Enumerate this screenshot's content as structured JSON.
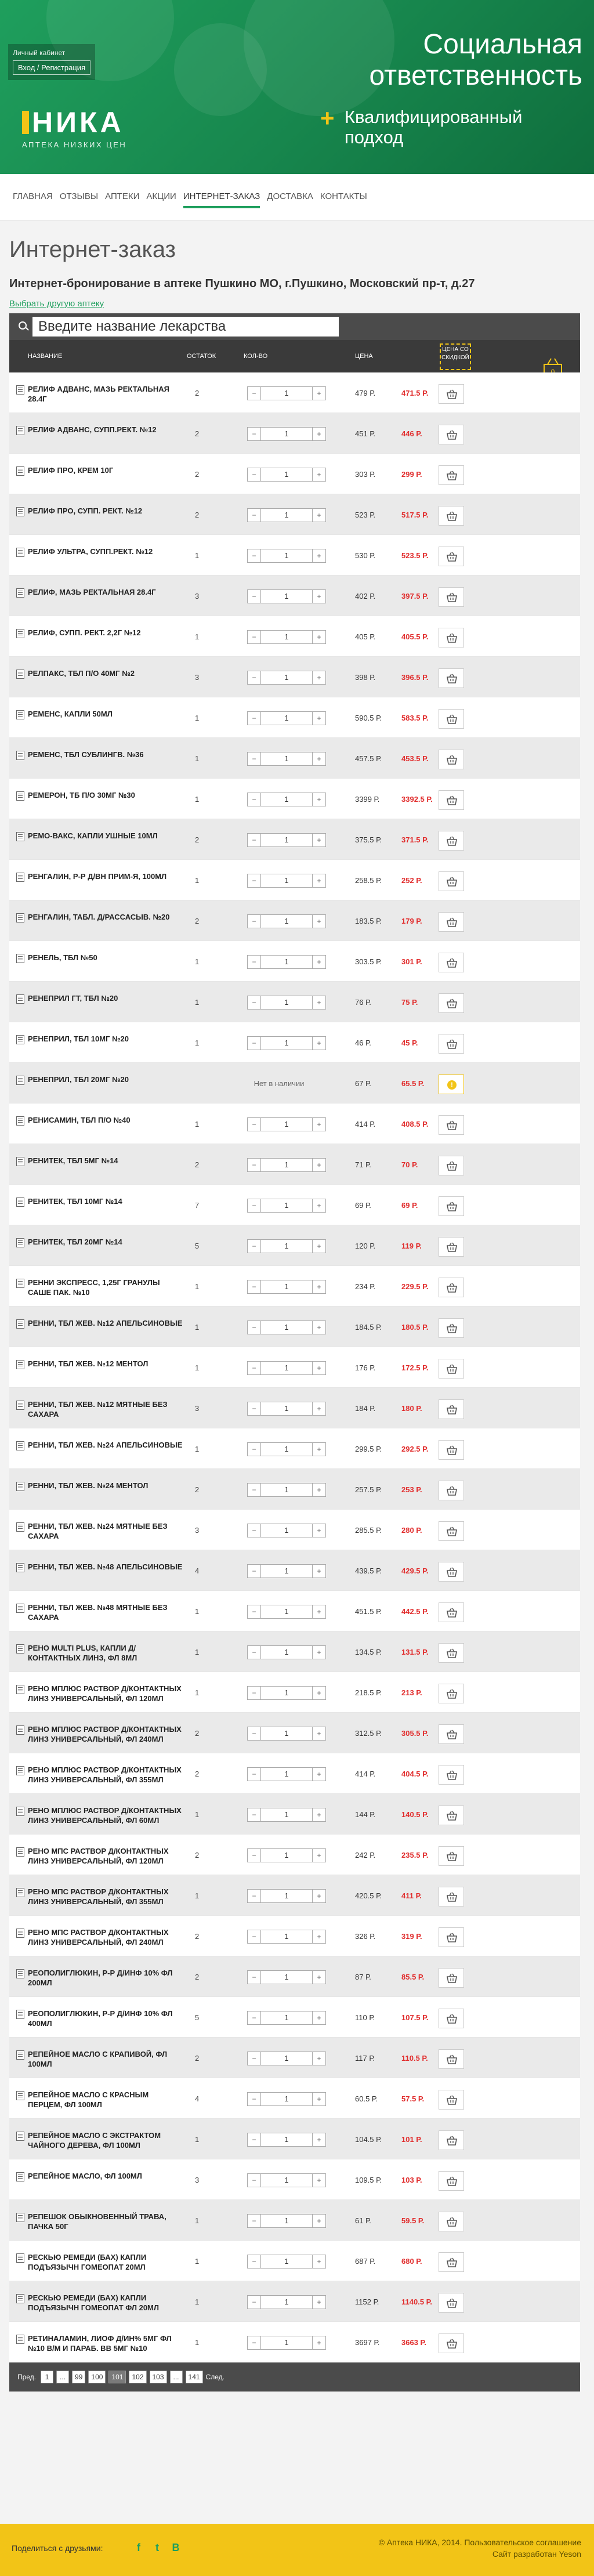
{
  "header": {
    "cabinet_title": "Личный кабинет",
    "login_link": "Вход / Регистрация",
    "logo_name": "НИКА",
    "logo_tagline": "АПТЕКА НИЗКИХ ЦЕН",
    "slogan_line1": "Социальная",
    "slogan_line2": "ответственность",
    "slogan_sub": "Квалифицированный подход"
  },
  "nav": [
    "Главная",
    "Отзывы",
    "Аптеки",
    "Акции",
    "Интернет-заказ",
    "Доставка",
    "Контакты"
  ],
  "nav_active": 4,
  "main": {
    "title": "Интернет-заказ",
    "subtitle": "Интернет-бронирование в аптеке Пушкино МО, г.Пушкино, Московский пр-т, д.27",
    "change_link": "Выбрать другую аптеку",
    "search_placeholder": "Введите название лекарства"
  },
  "table": {
    "headers": {
      "name": "Название",
      "stock": "Остаток",
      "qty": "Кол-во",
      "price": "Цена",
      "disc": "Цена со скидкой"
    },
    "cart_count": "0",
    "not_available": "Нет в наличии",
    "rows": [
      {
        "name": "Релиф адванс, мазь ректальная 28.4г",
        "stock": "2",
        "qty": "1",
        "price": "479 Р.",
        "disc": "471.5 Р."
      },
      {
        "name": "Релиф адванс, супп.рект. №12",
        "stock": "2",
        "qty": "1",
        "price": "451 Р.",
        "disc": "446 Р."
      },
      {
        "name": "Релиф про, крем 10г",
        "stock": "2",
        "qty": "1",
        "price": "303 Р.",
        "disc": "299 Р."
      },
      {
        "name": "Релиф про, супп. рект. №12",
        "stock": "2",
        "qty": "1",
        "price": "523 Р.",
        "disc": "517.5 Р."
      },
      {
        "name": "Релиф ультра, супп.рект. №12",
        "stock": "1",
        "qty": "1",
        "price": "530 Р.",
        "disc": "523.5 Р."
      },
      {
        "name": "Релиф, мазь ректальная 28.4г",
        "stock": "3",
        "qty": "1",
        "price": "402 Р.",
        "disc": "397.5 Р."
      },
      {
        "name": "Релиф, супп. рект. 2,2г №12",
        "stock": "1",
        "qty": "1",
        "price": "405 Р.",
        "disc": "405.5 Р."
      },
      {
        "name": "Релпакс, тбл п/о 40мг №2",
        "stock": "3",
        "qty": "1",
        "price": "398 Р.",
        "disc": "396.5 Р."
      },
      {
        "name": "Ременс, капли 50мл",
        "stock": "1",
        "qty": "1",
        "price": "590.5 Р.",
        "disc": "583.5 Р."
      },
      {
        "name": "Ременс, тбл сублингв. №36",
        "stock": "1",
        "qty": "1",
        "price": "457.5 Р.",
        "disc": "453.5 Р."
      },
      {
        "name": "Ремерон, тб п/о 30мг №30",
        "stock": "1",
        "qty": "1",
        "price": "3399 Р.",
        "disc": "3392.5 Р."
      },
      {
        "name": "Ремо-вакс, капли ушные 10мл",
        "stock": "2",
        "qty": "1",
        "price": "375.5 Р.",
        "disc": "371.5 Р."
      },
      {
        "name": "Ренгалин, р-р д/вн прим-я, 100мл",
        "stock": "1",
        "qty": "1",
        "price": "258.5 Р.",
        "disc": "252 Р."
      },
      {
        "name": "Ренгалин, табл. д/рассасыв. №20",
        "stock": "2",
        "qty": "1",
        "price": "183.5 Р.",
        "disc": "179 Р."
      },
      {
        "name": "Ренель, тбл №50",
        "stock": "1",
        "qty": "1",
        "price": "303.5 Р.",
        "disc": "301 Р."
      },
      {
        "name": "Ренеприл ГТ, тбл №20",
        "stock": "1",
        "qty": "1",
        "price": "76 Р.",
        "disc": "75 Р."
      },
      {
        "name": "Ренеприл, тбл 10мг №20",
        "stock": "1",
        "qty": "1",
        "price": "46 Р.",
        "disc": "45 Р."
      },
      {
        "name": "Ренеприл, тбл 20мг №20",
        "stock": "",
        "qty": "",
        "price": "67 Р.",
        "disc": "65.5 Р.",
        "na": true
      },
      {
        "name": "Ренисамин, тбл п/о №40",
        "stock": "1",
        "qty": "1",
        "price": "414 Р.",
        "disc": "408.5 Р."
      },
      {
        "name": "Ренитек, тбл 5мг №14",
        "stock": "2",
        "qty": "1",
        "price": "71 Р.",
        "disc": "70 Р."
      },
      {
        "name": "Ренитек, тбл 10мг №14",
        "stock": "7",
        "qty": "1",
        "price": "69 Р.",
        "disc": "69 Р."
      },
      {
        "name": "Ренитек, тбл 20мг №14",
        "stock": "5",
        "qty": "1",
        "price": "120 Р.",
        "disc": "119 Р."
      },
      {
        "name": "Ренни экспресс, 1,25г гранулы саше пак. №10",
        "stock": "1",
        "qty": "1",
        "price": "234 Р.",
        "disc": "229.5 Р."
      },
      {
        "name": "Ренни, тбл жев. №12 апельсиновые",
        "stock": "1",
        "qty": "1",
        "price": "184.5 Р.",
        "disc": "180.5 Р."
      },
      {
        "name": "Ренни, тбл жев. №12 ментол",
        "stock": "1",
        "qty": "1",
        "price": "176 Р.",
        "disc": "172.5 Р."
      },
      {
        "name": "Ренни, тбл жев. №12 мятные без сахара",
        "stock": "3",
        "qty": "1",
        "price": "184 Р.",
        "disc": "180 Р."
      },
      {
        "name": "Ренни, тбл жев. №24 апельсиновые",
        "stock": "1",
        "qty": "1",
        "price": "299.5 Р.",
        "disc": "292.5 Р."
      },
      {
        "name": "Ренни, тбл жев. №24 ментол",
        "stock": "2",
        "qty": "1",
        "price": "257.5 Р.",
        "disc": "253 Р."
      },
      {
        "name": "Ренни, тбл жев. №24 мятные без сахара",
        "stock": "3",
        "qty": "1",
        "price": "285.5 Р.",
        "disc": "280 Р."
      },
      {
        "name": "Ренни, тбл жев. №48 апельсиновые",
        "stock": "4",
        "qty": "1",
        "price": "439.5 Р.",
        "disc": "429.5 Р."
      },
      {
        "name": "Ренни, тбл жев. №48 мятные без сахара",
        "stock": "1",
        "qty": "1",
        "price": "451.5 Р.",
        "disc": "442.5 Р."
      },
      {
        "name": "Рено Multi Plus, капли д/контактных линз, фл 8мл",
        "stock": "1",
        "qty": "1",
        "price": "134.5 Р.",
        "disc": "131.5 Р."
      },
      {
        "name": "Рено мплюс раствор д/контактных линз универсальный, фл 120мл",
        "stock": "1",
        "qty": "1",
        "price": "218.5 Р.",
        "disc": "213 Р."
      },
      {
        "name": "Рено мплюс раствор д/контактных линз универсальный, фл 240мл",
        "stock": "2",
        "qty": "1",
        "price": "312.5 Р.",
        "disc": "305.5 Р."
      },
      {
        "name": "Рено мплюс раствор д/контактных линз универсальный, фл 355мл",
        "stock": "2",
        "qty": "1",
        "price": "414 Р.",
        "disc": "404.5 Р."
      },
      {
        "name": "Рено мплюс раствор д/контактных линз универсальный, фл 60мл",
        "stock": "1",
        "qty": "1",
        "price": "144 Р.",
        "disc": "140.5 Р."
      },
      {
        "name": "Рено мпс раствор д/контактных линз универсальный, фл 120мл",
        "stock": "2",
        "qty": "1",
        "price": "242 Р.",
        "disc": "235.5 Р."
      },
      {
        "name": "Рено мпс раствор д/контактных линз универсальный, фл 355мл",
        "stock": "1",
        "qty": "1",
        "price": "420.5 Р.",
        "disc": "411 Р."
      },
      {
        "name": "Рено мпс раствор д/контактных линз универсальный, фл 240мл",
        "stock": "2",
        "qty": "1",
        "price": "326 Р.",
        "disc": "319 Р."
      },
      {
        "name": "Реополиглюкин, р-р д/инф 10% фл 200мл",
        "stock": "2",
        "qty": "1",
        "price": "87 Р.",
        "disc": "85.5 Р."
      },
      {
        "name": "Реополиглюкин, р-р д/инф 10% фл 400мл",
        "stock": "5",
        "qty": "1",
        "price": "110 Р.",
        "disc": "107.5 Р."
      },
      {
        "name": "Репейное масло с крапивой, фл 100мл",
        "stock": "2",
        "qty": "1",
        "price": "117 Р.",
        "disc": "110.5 Р."
      },
      {
        "name": "Репейное масло с красным перцем, фл 100мл",
        "stock": "4",
        "qty": "1",
        "price": "60.5 Р.",
        "disc": "57.5 Р."
      },
      {
        "name": "Репейное масло с экстрактом чайного дерева, фл 100мл",
        "stock": "1",
        "qty": "1",
        "price": "104.5 Р.",
        "disc": "101 Р."
      },
      {
        "name": "Репейное масло, фл 100мл",
        "stock": "3",
        "qty": "1",
        "price": "109.5 Р.",
        "disc": "103 Р."
      },
      {
        "name": "Репешок обыкновенный трава, пачка 50г",
        "stock": "1",
        "qty": "1",
        "price": "61 Р.",
        "disc": "59.5 Р."
      },
      {
        "name": "Рескью ремеди (Бах) капли подъязычн гомеопат 20мл",
        "stock": "1",
        "qty": "1",
        "price": "687 Р.",
        "disc": "680 Р."
      },
      {
        "name": "Рескью ремеди (Бах) капли подъязычн гомеопат фл 20мл",
        "stock": "1",
        "qty": "1",
        "price": "1152 Р.",
        "disc": "1140.5 Р."
      },
      {
        "name": "Ретиналамин, лиоф д/ин% 5мг фл №10 в/м и параб. вв 5мг №10",
        "stock": "1",
        "qty": "1",
        "price": "3697 Р.",
        "disc": "3663 Р."
      }
    ]
  },
  "pager": {
    "prev": "Пред.",
    "next": "След.",
    "pages": [
      "1",
      "...",
      "99",
      "100",
      "101",
      "102",
      "103",
      "...",
      "141"
    ],
    "current": "101"
  },
  "footer": {
    "share": "Поделиться с друзьями:",
    "socials": [
      "f",
      "t",
      "В"
    ],
    "copyright": "© Аптека НИКА, 2014. Пользовательское соглашение",
    "dev": "Сайт разработан Yeson"
  },
  "colors": {
    "brand": "#1f9f5d",
    "accent": "#f2c417",
    "discount": "#e12d2d"
  }
}
